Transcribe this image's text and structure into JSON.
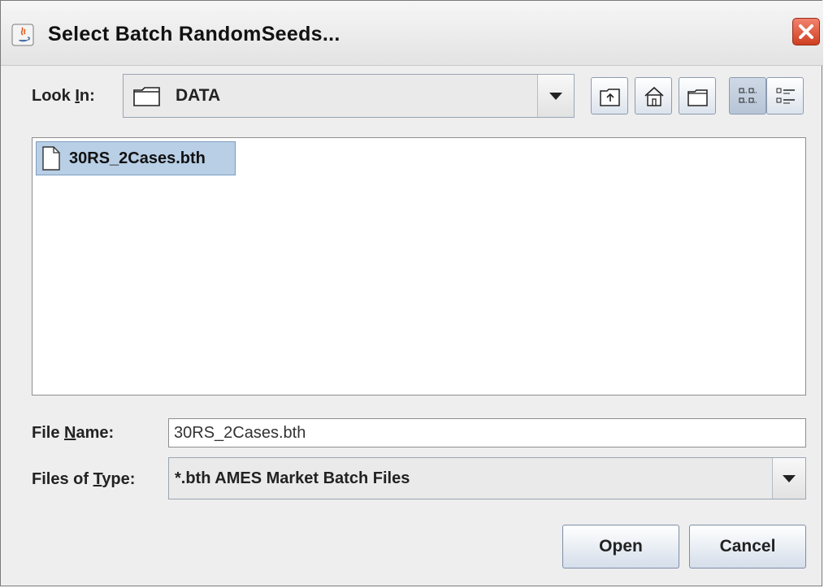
{
  "dialog": {
    "title": "Select Batch RandomSeeds..."
  },
  "look_in": {
    "label_pre": "Look ",
    "label_mnemonic": "I",
    "label_post": "n:",
    "value": "DATA"
  },
  "toolbar": {
    "buttons": [
      "up-folder-icon",
      "home-icon",
      "new-folder-icon",
      "list-view-icon",
      "details-view-icon"
    ]
  },
  "files": [
    {
      "name": "30RS_2Cases.bth",
      "selected": true
    }
  ],
  "file_name": {
    "label_pre": "File ",
    "label_mnemonic": "N",
    "label_post": "ame:",
    "value": "30RS_2Cases.bth"
  },
  "files_of_type": {
    "label_pre": "Files of ",
    "label_mnemonic": "T",
    "label_post": "ype:",
    "value": "*.bth AMES Market Batch Files"
  },
  "buttons": {
    "open": "Open",
    "cancel": "Cancel"
  },
  "colors": {
    "selection": "#b8cfe5",
    "close_button": "#d9492a"
  }
}
